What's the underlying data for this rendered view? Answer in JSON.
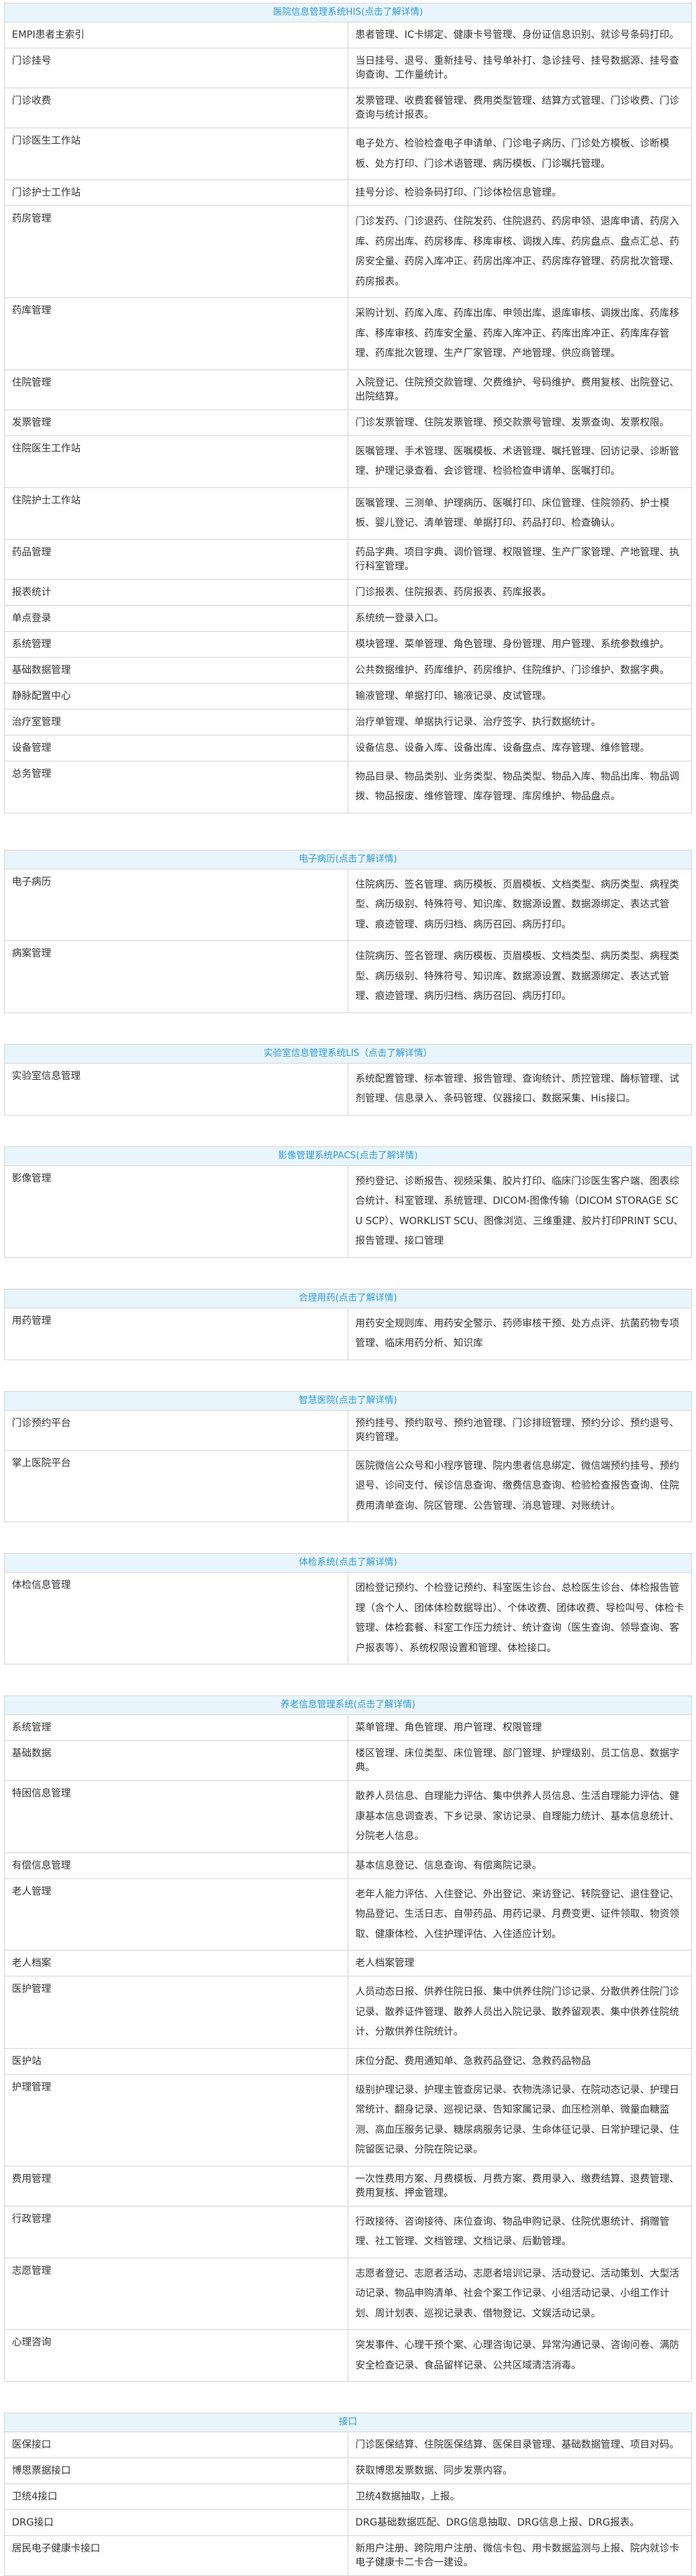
{
  "his": {
    "title": "医院信息管理系统HIS(点击了解详情)",
    "rows": [
      {
        "name": "EMPI患者主索引",
        "desc": "患者管理、IC卡绑定、健康卡号管理、身份证信息识别、就诊号条码打印。"
      },
      {
        "name": "门诊挂号",
        "desc": "当日挂号、退号、重新挂号、挂号单补打、急诊挂号、挂号数据源、挂号查询查询、工作量统计。"
      },
      {
        "name": "门诊收费",
        "desc": "发票管理、收费套餐管理、费用类型管理、结算方式管理、门诊收费、门诊查询与统计报表。"
      },
      {
        "name": "门诊医生工作站",
        "desc": "电子处方、检验检查电子申请单、门诊电子病历、门诊处方模板、诊断模板、处方打印、门诊术语管理、病历模板、门诊嘱托管理。"
      },
      {
        "name": "门诊护士工作站",
        "desc": "挂号分诊、检验条码打印、门诊体检信息管理。"
      },
      {
        "name": "药房管理",
        "desc": "门诊发药、门诊退药、住院发药、住院退药、药房申领、退库申请、药房入库、药房出库、药房移库、移库审核、调拨入库、药房盘点、盘点汇总、药房安全量、药房入库冲正、药房出库冲正、药房库存管理、药房批次管理、药房报表。"
      },
      {
        "name": "药库管理",
        "desc": "采购计划、药库入库、药库出库、申领出库、退库审核、调拨出库、药库移库、移库审核、药库安全量、药库入库冲正、药库出库冲正、药库库存管理、药库批次管理、生产厂家管理、产地管理、供应商管理。"
      },
      {
        "name": "住院管理",
        "desc": "入院登记、住院预交款管理、欠费维护、号码维护、费用复核、出院登记、出院结算。"
      },
      {
        "name": "发票管理",
        "desc": "门诊发票管理、住院发票管理、预交款票号管理、发票查询、发票权限。"
      },
      {
        "name": "住院医生工作站",
        "desc": "医嘱管理、手术管理、医嘱模板、术语管理、嘱托管理、回访记录、诊断管理、护理记录查看、会诊管理、检验检查申请单、医嘱打印。"
      },
      {
        "name": "住院护士工作站",
        "desc": "医嘱管理、三测单、护理病历、医嘱打印、床位管理、住院领药、护士模板、婴儿登记、清单管理、单据打印、药品打印、检查确认。"
      },
      {
        "name": "药品管理",
        "desc": "药品字典、项目字典、调价管理、权限管理、生产厂家管理、产地管理、执行科室管理。"
      },
      {
        "name": "报表统计",
        "desc": "门诊报表、住院报表、药房报表、药库报表。"
      },
      {
        "name": "单点登录",
        "desc": "系统统一登录入口。"
      },
      {
        "name": "系统管理",
        "desc": "模块管理、菜单管理、角色管理、身份管理、用户管理、系统参数维护。"
      },
      {
        "name": "基础数据管理",
        "desc": "公共数据维护、药库维护、药房维护、住院维护、门诊维护、数据字典。"
      },
      {
        "name": "静脉配置中心",
        "desc": "输液管理、单据打印、输液记录、皮试管理。"
      },
      {
        "name": "治疗室管理",
        "desc": "治疗单管理、单据执行记录、治疗签字、执行数据统计。"
      },
      {
        "name": "设备管理",
        "desc": "设备信息、设备入库、设备出库、设备盘点、库存管理、维修管理。"
      },
      {
        "name": "总务管理",
        "desc": "物品目录、物品类别、业务类型、物品类型、物品入库、物品出库、物品调拨、物品报废、维修管理、库存管理、库房维护、物品盘点。"
      }
    ]
  },
  "emr": {
    "title": "电子病历(点击了解详情)",
    "rows": [
      {
        "name": "电子病历",
        "desc": "住院病历、签名管理、病历模板、页眉模板、文档类型、病历类型、病程类型、病历级别、特殊符号、知识库、数据源设置、数据源绑定、表达式管理、痕迹管理、病历归档、病历召回、病历打印。"
      },
      {
        "name": "病案管理",
        "desc": "住院病历、签名管理、病历模板、页眉模板、文档类型、病历类型、病程类型、病历级别、特殊符号、知识库、数据源设置、数据源绑定、表达式管理、痕迹管理、病历归档、病历召回、病历打印。"
      }
    ]
  },
  "lis": {
    "title": "实验室信息管理系统LIS（点击了解详情）",
    "rows": [
      {
        "name": "实验室信息管理",
        "desc": "系统配置管理、标本管理、报告管理、查询统计、质控管理、酶标管理、试剂管理、信息录入、条码管理、仪器接口、数据采集、His接口。"
      }
    ]
  },
  "pacs": {
    "title": "影像管理系统PACS(点击了解详情)",
    "rows": [
      {
        "name": "影像管理",
        "desc": "预约登记、诊断报告、视频采集、胶片打印、临床门诊医生客户端、图表综合统计、科室管理、系统管理、DICOM-图像传输（DICOM STORAGE SCU SCP）、WORKLIST SCU、图像浏览、三维重建、胶片打印PRINT SCU、报告管理、接口管理"
      }
    ]
  },
  "drug": {
    "title": "合理用药(点击了解详情)",
    "rows": [
      {
        "name": "用药管理",
        "desc": "用药安全规则库、用药安全警示、药师审核干预、处方点评、抗菌药物专项管理、临床用药分析、知识库"
      }
    ]
  },
  "smart": {
    "title": "智慧医院(点击了解详情)",
    "rows": [
      {
        "name": "门诊预约平台",
        "desc": "预约挂号、预约取号、预约池管理、门诊排班管理、预约分诊、预约退号、爽约管理。"
      },
      {
        "name": "掌上医院平台",
        "desc": "医院微信公众号和小程序管理、院内患者信息绑定、微信端预约挂号、预约退号、诊间支付、候诊信息查询、缴费信息查询、检验检查报告查询、住院费用清单查询、院区管理、公告管理、消息管理、对账统计。"
      }
    ]
  },
  "exam": {
    "title": "体检系统(点击了解详情)",
    "rows": [
      {
        "name": "体检信息管理",
        "desc": "团检登记预约、个检登记预约、科室医生诊台、总检医生诊台、体检报告管理（含个人、团体体检数据导出）、个体收费、团体收费、导检叫号、体检卡管理、体检套餐、科室工作压力统计、统计查询（医生查询、领导查询、客户报表等）、系统权限设置和管理、体检接口。"
      }
    ]
  },
  "elder": {
    "title": "养老信息管理系统(点击了解详情)",
    "rows": [
      {
        "name": "系统管理",
        "desc": "菜单管理、角色管理、用户管理、权限管理"
      },
      {
        "name": "基础数据",
        "desc": "楼区管理、床位类型、床位管理、部门管理、护理级别、员工信息、数据字典。"
      },
      {
        "name": "特困信息管理",
        "desc": "散养人员信息、自理能力评估、集中供养人员信息、生活自理能力评估、健康基本信息调查表、下乡记录、家访记录、自理能力统计、基本信息统计、分院老人信息。"
      },
      {
        "name": "有偿信息管理",
        "desc": "基本信息登记、信息查询、有偿离院记录。"
      },
      {
        "name": "老人管理",
        "desc": "老年人能力评估、入住登记、外出登记、来访登记、转院登记、退住登记、物品登记、生活日志、自带药品、用药记录、月费变更、证件领取、物资领取、健康体检、入住护理评估、入住适应计划。"
      },
      {
        "name": "老人档案",
        "desc": "老人档案管理"
      },
      {
        "name": "医护管理",
        "desc": "人员动态日报、供养住院日报、集中供养住院门诊记录、分散供养住院门诊记录、散养证件管理、散养人员出入院记录、散养留观表、集中供养住院统计、分散供养住院统计。"
      },
      {
        "name": "医护站",
        "desc": "床位分配、费用通知单、急救药品登记、急救药品物品"
      },
      {
        "name": "护理管理",
        "desc": "级别护理记录、护理主管查房记录、衣物洗涤记录、在院动态记录、护理日常统计、翻身记录、巡视记录、告知家属记录、血压检测单、微量血糖监测、高血压服务记录、糖尿病服务记录、生命体征记录、日常护理记录、住院留医记录、分院在院记录。"
      },
      {
        "name": "费用管理",
        "desc": "一次性费用方案、月费模板、月费方案、费用录入、缴费结算、退费管理、费用复核、押金管理。"
      },
      {
        "name": "行政管理",
        "desc": "行政接待、咨询接待、床位查询、物品申购记录、住院优惠统计、捐赠管理、社工管理、文档管理、文档记录、后勤管理。"
      },
      {
        "name": "志愿管理",
        "desc": "志愿者登记、志愿者活动、志愿者培训记录、活动登记、活动策划、大型活动记录、物品申购清单、社会个案工作记录、小组活动记录、小组工作计划、周计划表、巡视记录表、借物登记、文娱活动记录。"
      },
      {
        "name": "心理咨询",
        "desc": "突发事件、心理干预个案、心理咨询记录、异常沟通记录、咨询问卷、满防安全检查记录、食品留样记录、公共区域清洁消毒。"
      }
    ]
  },
  "iface": {
    "title": "接口",
    "rows": [
      {
        "name": "医保接口",
        "desc": "门诊医保结算、住院医保结算、医保目录管理、基础数据管理、项目对码。"
      },
      {
        "name": "博思票据接口",
        "desc": "获取博思发票数据、同步发票内容。"
      },
      {
        "name": "卫统4接口",
        "desc": "卫统4数据抽取，上报。"
      },
      {
        "name": "DRG接口",
        "desc": "DRG基础数据匹配、DRG信息抽取、DRG信息上报、DRG报表。"
      },
      {
        "name": "居民电子健康卡接口",
        "desc": "新用户注册、跨院用户注册、微信卡包、用卡数据监测与上报、院内就诊卡电子健康卡二卡合一建设。"
      }
    ]
  }
}
